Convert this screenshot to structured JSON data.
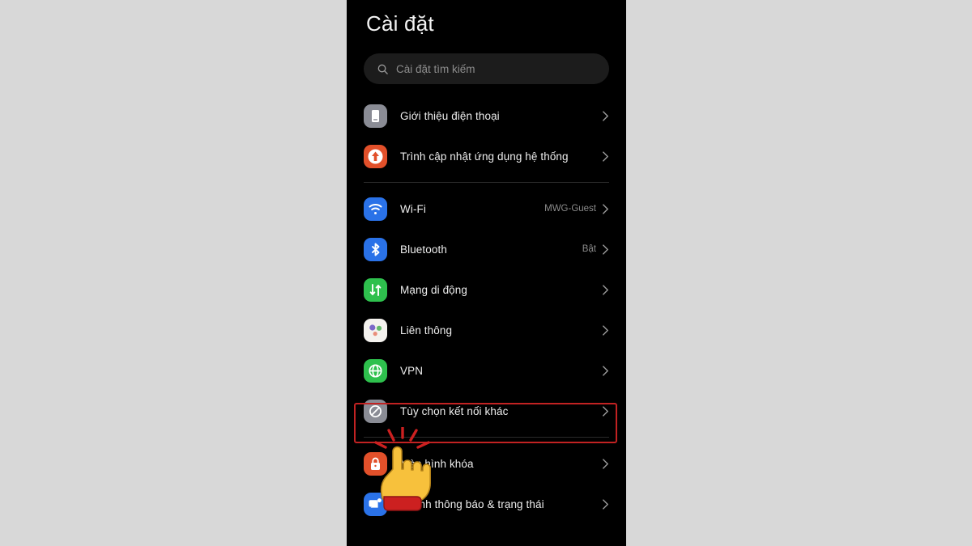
{
  "header": {
    "title": "Cài đặt"
  },
  "search": {
    "placeholder": "Cài đặt tìm kiếm",
    "icon": "search-icon"
  },
  "colors": {
    "background": "#d8d8d8",
    "screen": "#000000",
    "highlight": "#c22222",
    "accent_blue": "#2a72e8",
    "accent_green": "#2ec04d",
    "accent_orange": "#e2502a",
    "accent_grey": "#8a8c95",
    "text": "#ededed",
    "text_secondary": "#8c8c8c"
  },
  "list": {
    "groups": [
      {
        "items": [
          {
            "label": "Giới thiệu điện thoại",
            "value": "",
            "icon": "phone-icon",
            "highlighted": false
          },
          {
            "label": "Trình cập nhật ứng dụng hệ thống",
            "value": "",
            "icon": "system-update-icon",
            "highlighted": false
          }
        ]
      },
      {
        "items": [
          {
            "label": "Wi-Fi",
            "value": "MWG-Guest",
            "icon": "wifi-icon",
            "highlighted": false
          },
          {
            "label": "Bluetooth",
            "value": "Bật",
            "icon": "bluetooth-icon",
            "highlighted": false
          },
          {
            "label": "Mạng di động",
            "value": "",
            "icon": "mobile-network-icon",
            "highlighted": false
          },
          {
            "label": "Liên thông",
            "value": "",
            "icon": "interconnect-icon",
            "highlighted": false
          },
          {
            "label": "VPN",
            "value": "",
            "icon": "vpn-globe-icon",
            "highlighted": false
          },
          {
            "label": "Tùy chọn kết nối khác",
            "value": "",
            "icon": "other-connection-icon",
            "highlighted": true
          }
        ]
      },
      {
        "items": [
          {
            "label": "Màn hình khóa",
            "value": "",
            "icon": "lock-screen-icon",
            "highlighted": false
          },
          {
            "label": "Thanh thông báo & trạng thái",
            "value": "",
            "icon": "notification-bar-icon",
            "highlighted": false
          }
        ]
      }
    ]
  },
  "annotation": {
    "cursor": "pointing-hand-cursor",
    "target_label": "Tùy chọn kết nối khác"
  }
}
